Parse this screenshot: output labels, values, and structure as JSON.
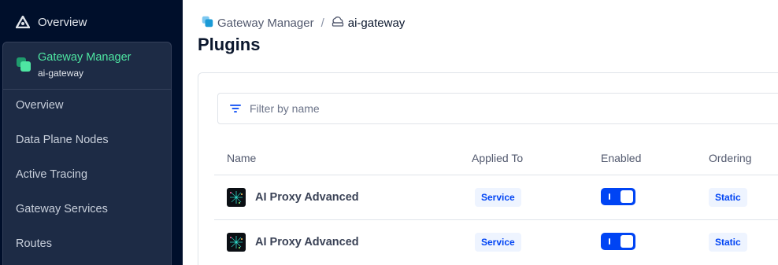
{
  "sidebar": {
    "top_item": {
      "label": "Overview",
      "icon": "kong-logo-icon"
    },
    "control_plane": {
      "title": "Gateway Manager",
      "subtitle": "ai-gateway",
      "icon": "gateway-manager-icon"
    },
    "items": [
      {
        "label": "Overview"
      },
      {
        "label": "Data Plane Nodes"
      },
      {
        "label": "Active Tracing"
      },
      {
        "label": "Gateway Services"
      },
      {
        "label": "Routes"
      }
    ]
  },
  "breadcrumb": {
    "parent": {
      "label": "Gateway Manager",
      "icon": "gateway-manager-icon"
    },
    "separator": "/",
    "current": {
      "label": "ai-gateway",
      "icon": "cloud-gateway-icon"
    }
  },
  "page": {
    "title": "Plugins"
  },
  "filter": {
    "placeholder": "Filter by name",
    "value": "",
    "icon": "filter-icon"
  },
  "table": {
    "columns": [
      "Name",
      "Applied To",
      "Enabled",
      "Ordering"
    ],
    "rows": [
      {
        "name": "AI Proxy Advanced",
        "applied_to": "Service",
        "enabled": true,
        "ordering": "Static"
      },
      {
        "name": "AI Proxy Advanced",
        "applied_to": "Service",
        "enabled": true,
        "ordering": "Static"
      }
    ]
  },
  "colors": {
    "sidebar_bg": "#000f2b",
    "panel_bg": "#1d2b45",
    "accent_green": "#4ee6a2",
    "primary_blue": "#0044f4",
    "badge_bg": "#eef4ff"
  }
}
